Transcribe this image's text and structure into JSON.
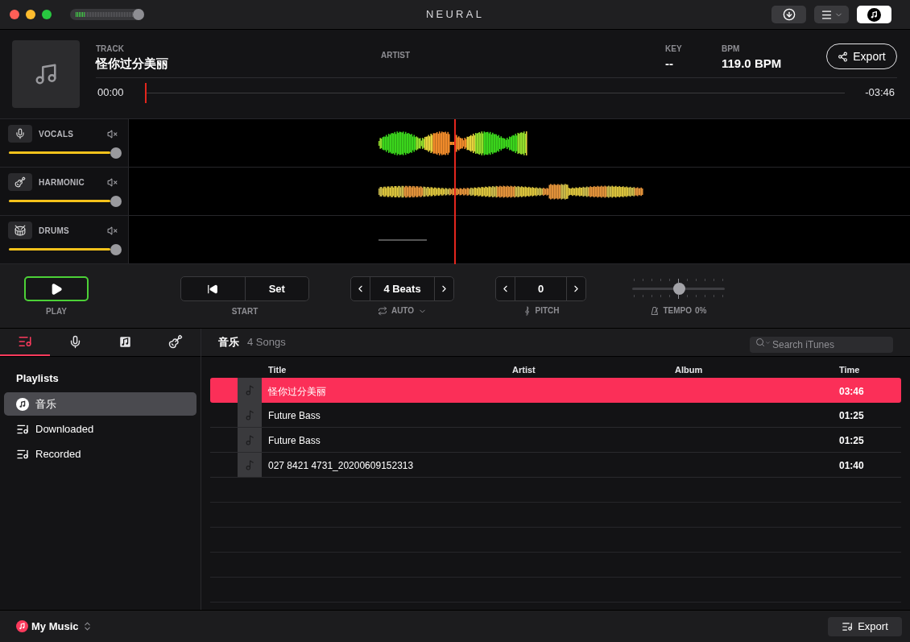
{
  "window": {
    "logo": "NEURAL"
  },
  "master_volume": {
    "level": 0.92
  },
  "toolbar_buttons": [
    {
      "kind": "download",
      "on": false
    },
    {
      "kind": "menu",
      "on": false
    },
    {
      "kind": "library",
      "on": true
    }
  ],
  "track": {
    "track_label": "TRACK",
    "title": "怪你过分美丽",
    "artist_label": "ARTIST",
    "key_label": "KEY",
    "key": "--",
    "bpm_label": "BPM",
    "bpm": "119.0 BPM",
    "export": "Export",
    "elapsed": "00:00",
    "remaining": "-03:46",
    "progress": {
      "level": 0
    }
  },
  "stems": [
    {
      "kind": "vocals",
      "name": "VOCALS",
      "volume": {
        "level": 1
      }
    },
    {
      "kind": "harmonic",
      "name": "HARMONIC",
      "volume": {
        "level": 1
      }
    },
    {
      "kind": "drums",
      "name": "DRUMS",
      "volume": {
        "level": 1
      }
    }
  ],
  "transport": {
    "play": {
      "label": "PLAY"
    },
    "start": {
      "set": "Set",
      "label": "START"
    },
    "loop": {
      "value": "4 Beats",
      "label": "AUTO"
    },
    "pitch": {
      "value": "0",
      "label": "PITCH"
    },
    "tempo": {
      "label": "TEMPO",
      "reading": "0%",
      "level": 0.5
    }
  },
  "library": {
    "tabs": [
      {
        "kind": "playlists",
        "selected": true
      },
      {
        "kind": "vocals",
        "selected": false
      },
      {
        "kind": "songs",
        "selected": false
      },
      {
        "kind": "instruments",
        "selected": false
      }
    ],
    "heading": "Playlists",
    "playlists": [
      {
        "kind": "music",
        "label": "音乐",
        "selected": true
      },
      {
        "kind": "playlist",
        "label": "Downloaded",
        "selected": false
      },
      {
        "kind": "playlist",
        "label": "Recorded",
        "selected": false
      }
    ]
  },
  "list": {
    "title": "音乐",
    "count": "4 Songs",
    "search": {
      "placeholder": "Search iTunes"
    },
    "columns": [
      "Title",
      "Artist",
      "Album",
      "Time"
    ],
    "rows": [
      {
        "title": "怪你过分美丽",
        "time": "03:46",
        "selected": true
      },
      {
        "title": "Future Bass",
        "time": "01:25",
        "selected": false
      },
      {
        "title": "Future Bass",
        "time": "01:25",
        "selected": false
      },
      {
        "title": "027 8421 4731_20200609152313",
        "time": "01:40",
        "selected": false
      }
    ]
  },
  "footer": {
    "source": "My Music",
    "export": "Export"
  }
}
